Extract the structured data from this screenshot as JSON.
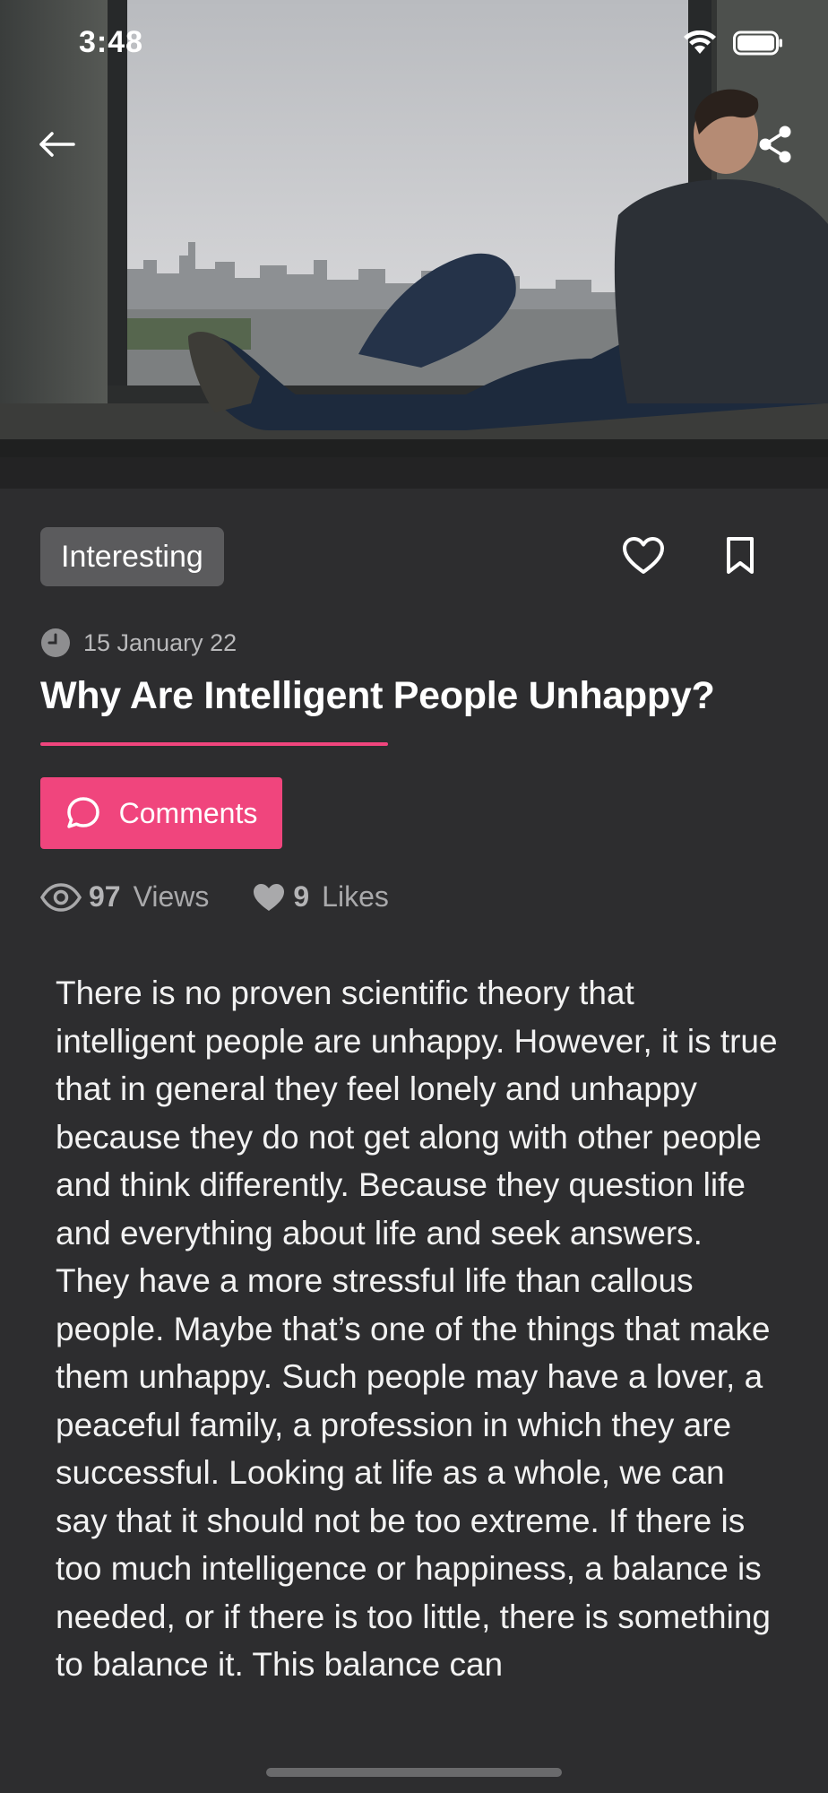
{
  "status_bar": {
    "time": "3:48"
  },
  "hero": {
    "image_icon": "man-sitting-by-window-photo"
  },
  "header": {
    "back_icon": "arrow-left-icon",
    "share_icon": "share-icon"
  },
  "article": {
    "category": "Interesting",
    "date": "15 January 22",
    "title": "Why Are Intelligent People Unhappy?",
    "comments_label": "Comments",
    "views_count": "97",
    "views_label": "Views",
    "likes_count": "9",
    "likes_label": "Likes",
    "body": "There is no proven scientific theory that intelligent people are unhappy. However, it is true that in general they feel lonely and unhappy because they do not get along with other people and think differently. Because they question life and everything about life and seek answers. They have a more stressful life than callous people. Maybe that’s one of the things that make them unhappy. Such people may have a lover, a peaceful family, a profession in which they are successful. Looking at life as a whole, we can say that it should not be too extreme. If there is too much intelligence or happiness, a balance is needed, or if there is too little, there is something to balance it. This balance can"
  },
  "colors": {
    "background": "#2d2d2f",
    "accent": "#f0457d",
    "tag_background": "#5b5b5d",
    "muted_text": "#a9a9ab"
  }
}
